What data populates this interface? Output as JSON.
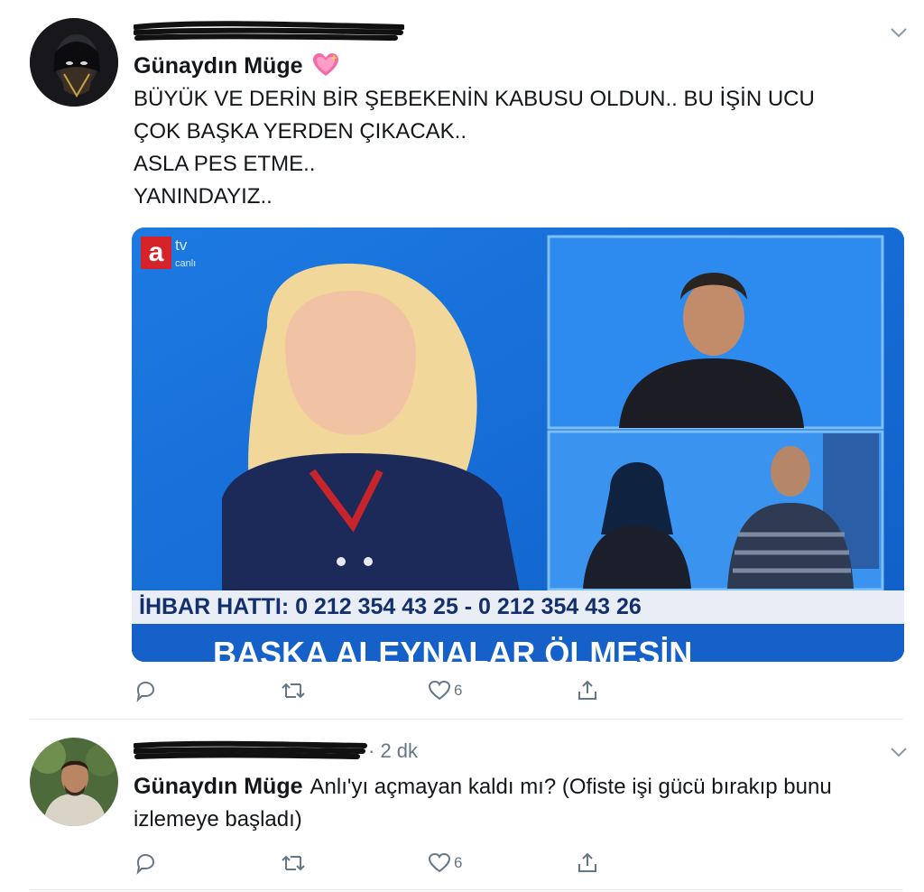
{
  "tweets": [
    {
      "display_name": "Günaydın Müge",
      "lines": [
        "BÜYÜK VE DERİN BİR ŞEBEKENİN KABUSU OLDUN.. BU İŞİN UCU",
        "ÇOK BAŞKA YERDEN ÇIKACAK..",
        "ASLA PES ETME..",
        "YANINDAYIZ.."
      ],
      "like_count": "6"
    },
    {
      "display_name": "Günaydın Müge",
      "time": "· 2 dk",
      "lines": [
        "Anlı'yı açmayan kaldı mı? (Ofiste işi gücü bırakıp bunu",
        "izlemeye başladı)"
      ],
      "like_count": "6"
    }
  ],
  "media": {
    "channel_logo_letter": "a",
    "channel_logo_sub": "tv",
    "channel_live": "canlı",
    "ticker_hotline": "İHBAR HATTI: 0 212 354 43 25 - 0 212 354 43 26",
    "ticker_banner": "BAŞKA ALEYNALAR ÖLMESİN"
  },
  "icons": {
    "reply": "reply-icon",
    "retweet": "retweet-icon",
    "like": "heart-icon",
    "share": "share-icon",
    "menu": "chevron-down-icon",
    "emoji": "sparkling-heart-emoji"
  },
  "colors": {
    "meta": "#657786",
    "divider": "#e1e8ed",
    "tv_blue": "#1a6fd8"
  }
}
